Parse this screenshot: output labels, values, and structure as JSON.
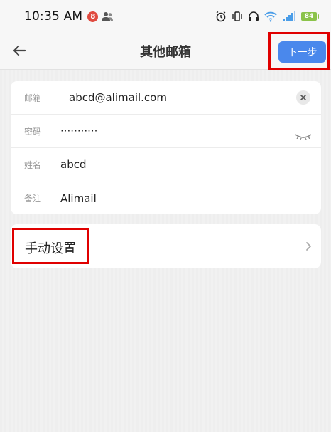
{
  "status_bar": {
    "time": "10:35 AM",
    "notification_count": "8",
    "battery_level": "84",
    "icons": [
      "person-icon",
      "alarm-icon",
      "vibrate-icon",
      "headphones-icon",
      "wifi-icon",
      "signal-icon",
      "battery-icon"
    ]
  },
  "nav": {
    "title": "其他邮箱",
    "back_icon": "arrow-left-icon",
    "next_label": "下一步"
  },
  "form": {
    "email_label": "邮箱",
    "email_value": "abcd@alimail.com",
    "password_label": "密码",
    "password_value": "···········",
    "name_label": "姓名",
    "name_value": "abcd",
    "note_label": "备注",
    "note_value": "Alimail"
  },
  "manual": {
    "label": "手动设置"
  },
  "colors": {
    "accent": "#4a88ec",
    "highlight": "#e00000",
    "badge": "#e04a3f",
    "battery": "#8bc34a"
  }
}
